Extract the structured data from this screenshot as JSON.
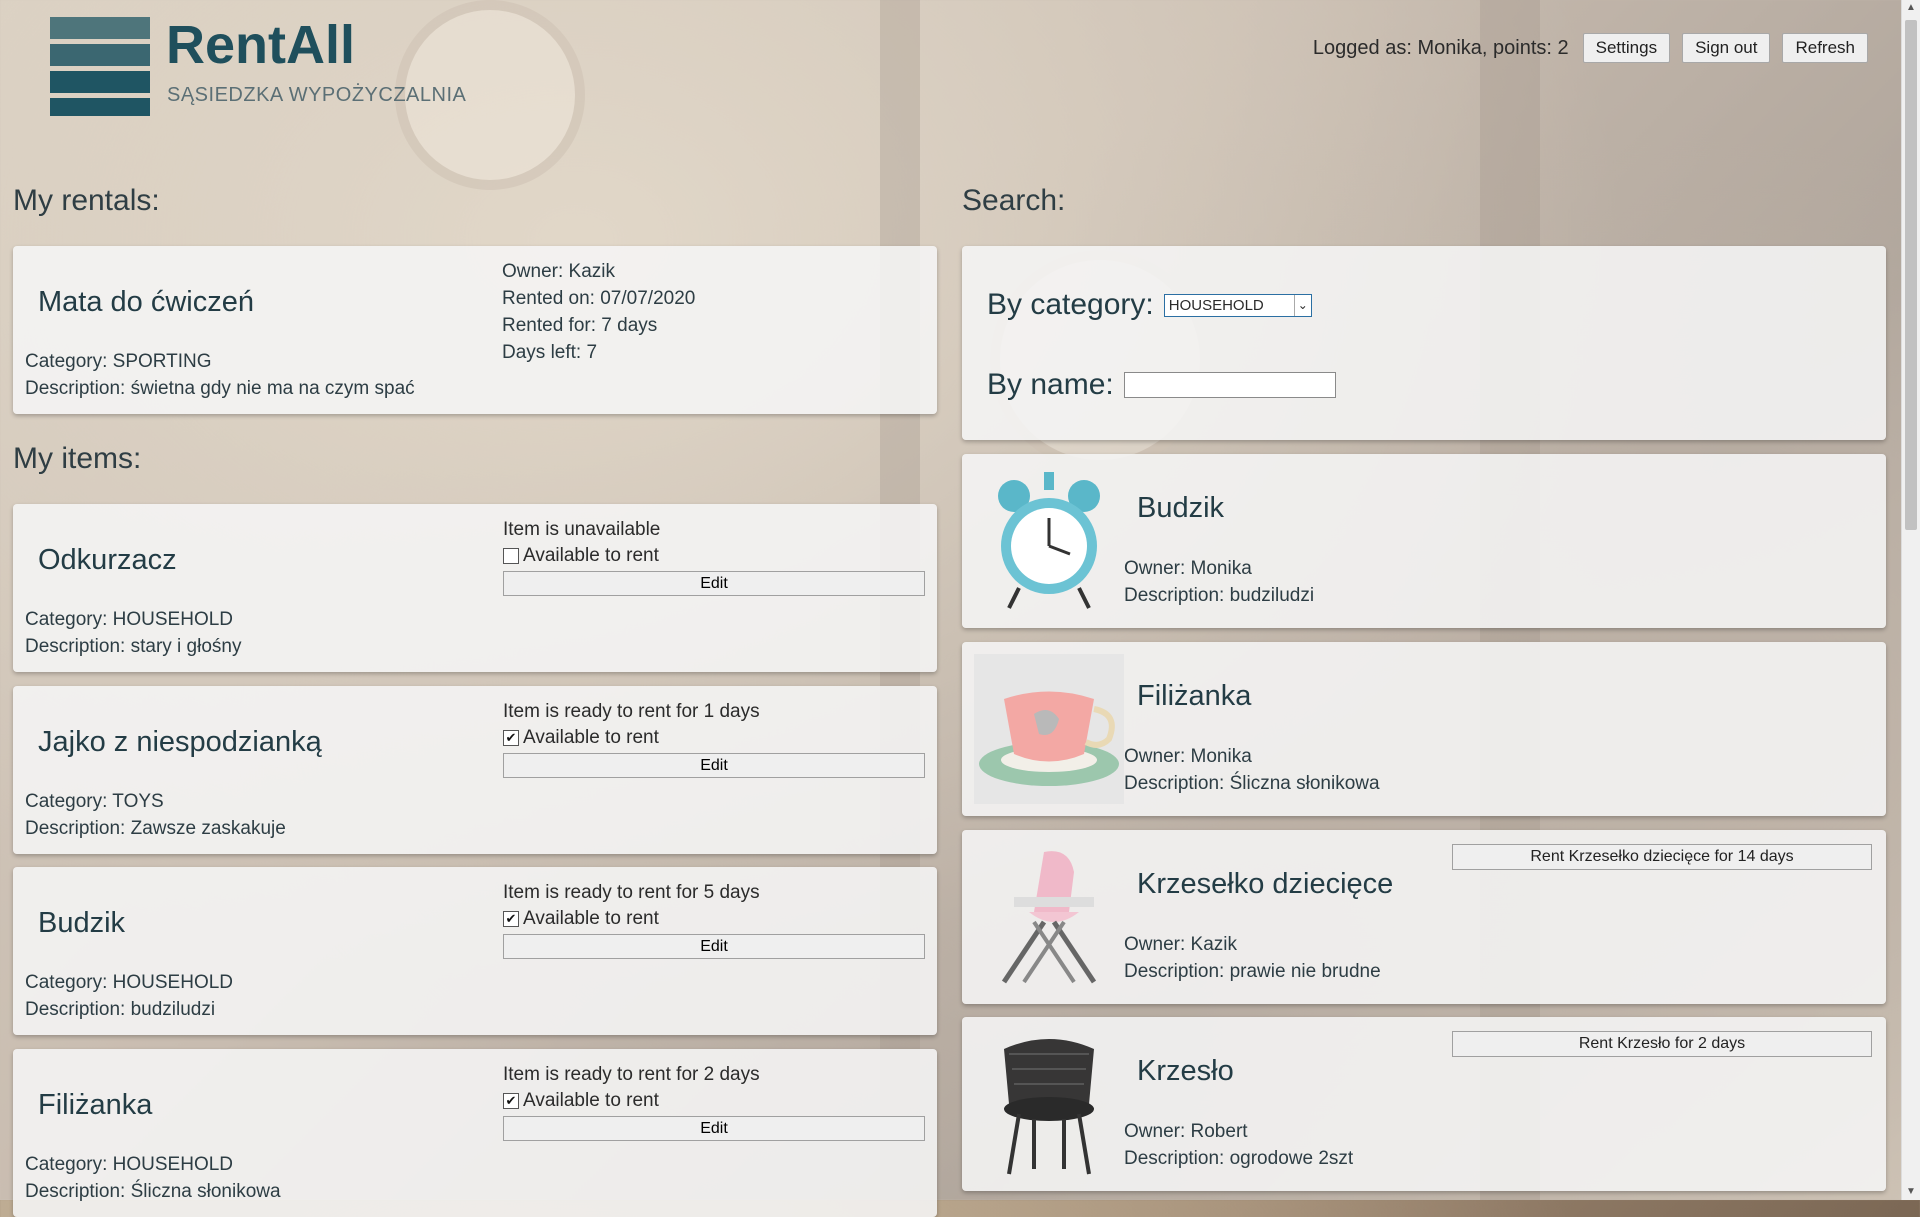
{
  "app": {
    "title": "RentAll",
    "subtitle": "SĄSIEDZKA WYPOŻYCZALNIA",
    "brand_color": "#1f5563"
  },
  "header": {
    "status": "Logged as: Monika, points: 2",
    "settings_label": "Settings",
    "signout_label": "Sign out",
    "refresh_label": "Refresh"
  },
  "my_rentals": {
    "title": "My rentals:",
    "items": [
      {
        "name": "Mata do ćwiczeń",
        "category": "Category: SPORTING",
        "description": "Description: świetna gdy nie ma na czym spać",
        "owner": "Owner: Kazik",
        "rented_on": "Rented on: 07/07/2020",
        "rented_for": "Rented for: 7 days",
        "days_left": "Days left: 7"
      }
    ]
  },
  "my_items": {
    "title": "My items:",
    "available_label": "Available to rent",
    "edit_label": "Edit",
    "items": [
      {
        "name": "Odkurzacz",
        "category": "Category: HOUSEHOLD",
        "description": "Description: stary i głośny",
        "status": "Item is unavailable",
        "available": false
      },
      {
        "name": "Jajko z niespodzianką",
        "category": "Category: TOYS",
        "description": "Description: Zawsze zaskakuje",
        "status": "Item is ready to rent for 1 days",
        "available": true
      },
      {
        "name": "Budzik",
        "category": "Category: HOUSEHOLD",
        "description": "Description: budziludzi",
        "status": "Item is ready to rent for 5 days",
        "available": true
      },
      {
        "name": "Filiżanka",
        "category": "Category: HOUSEHOLD",
        "description": "Description: Śliczna słonikowa",
        "status": "Item is ready to rent for 2 days",
        "available": true
      }
    ]
  },
  "search": {
    "title": "Search:",
    "category_label": "By category:",
    "category_value": "HOUSEHOLD",
    "name_label": "By name:",
    "name_value": "",
    "results": [
      {
        "name": "Budzik",
        "owner": "Owner: Monika",
        "description": "Description: budziludzi",
        "image_icon": "alarm-clock-icon",
        "rent_label": ""
      },
      {
        "name": "Filiżanka",
        "owner": "Owner: Monika",
        "description": "Description: Śliczna słonikowa",
        "image_icon": "teacup-icon",
        "rent_label": ""
      },
      {
        "name": "Krzesełko dziecięce",
        "owner": "Owner: Kazik",
        "description": "Description: prawie nie brudne",
        "image_icon": "high-chair-icon",
        "rent_label": "Rent Krzesełko dziecięce for 14 days"
      },
      {
        "name": "Krzesło",
        "owner": "Owner: Robert",
        "description": "Description: ogrodowe 2szt",
        "image_icon": "chair-icon",
        "rent_label": "Rent Krzesło for 2 days"
      }
    ]
  }
}
